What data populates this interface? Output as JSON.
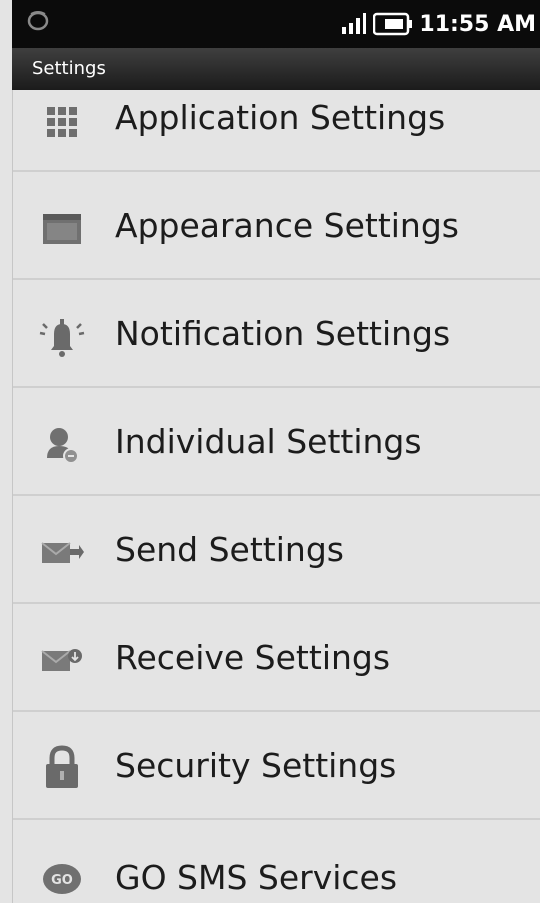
{
  "status_bar": {
    "time": "11:55 AM"
  },
  "title_bar": {
    "title": "Settings"
  },
  "settings_list": {
    "items": [
      {
        "label": "Application Settings",
        "icon": "grid-icon"
      },
      {
        "label": "Appearance Settings",
        "icon": "window-icon"
      },
      {
        "label": "Notification Settings",
        "icon": "bell-icon"
      },
      {
        "label": "Individual Settings",
        "icon": "person-icon"
      },
      {
        "label": "Send Settings",
        "icon": "send-mail-icon"
      },
      {
        "label": "Receive Settings",
        "icon": "receive-mail-icon"
      },
      {
        "label": "Security Settings",
        "icon": "lock-icon"
      },
      {
        "label": "GO SMS Services",
        "icon": "go-badge-icon",
        "badge_text": "GO"
      }
    ]
  }
}
